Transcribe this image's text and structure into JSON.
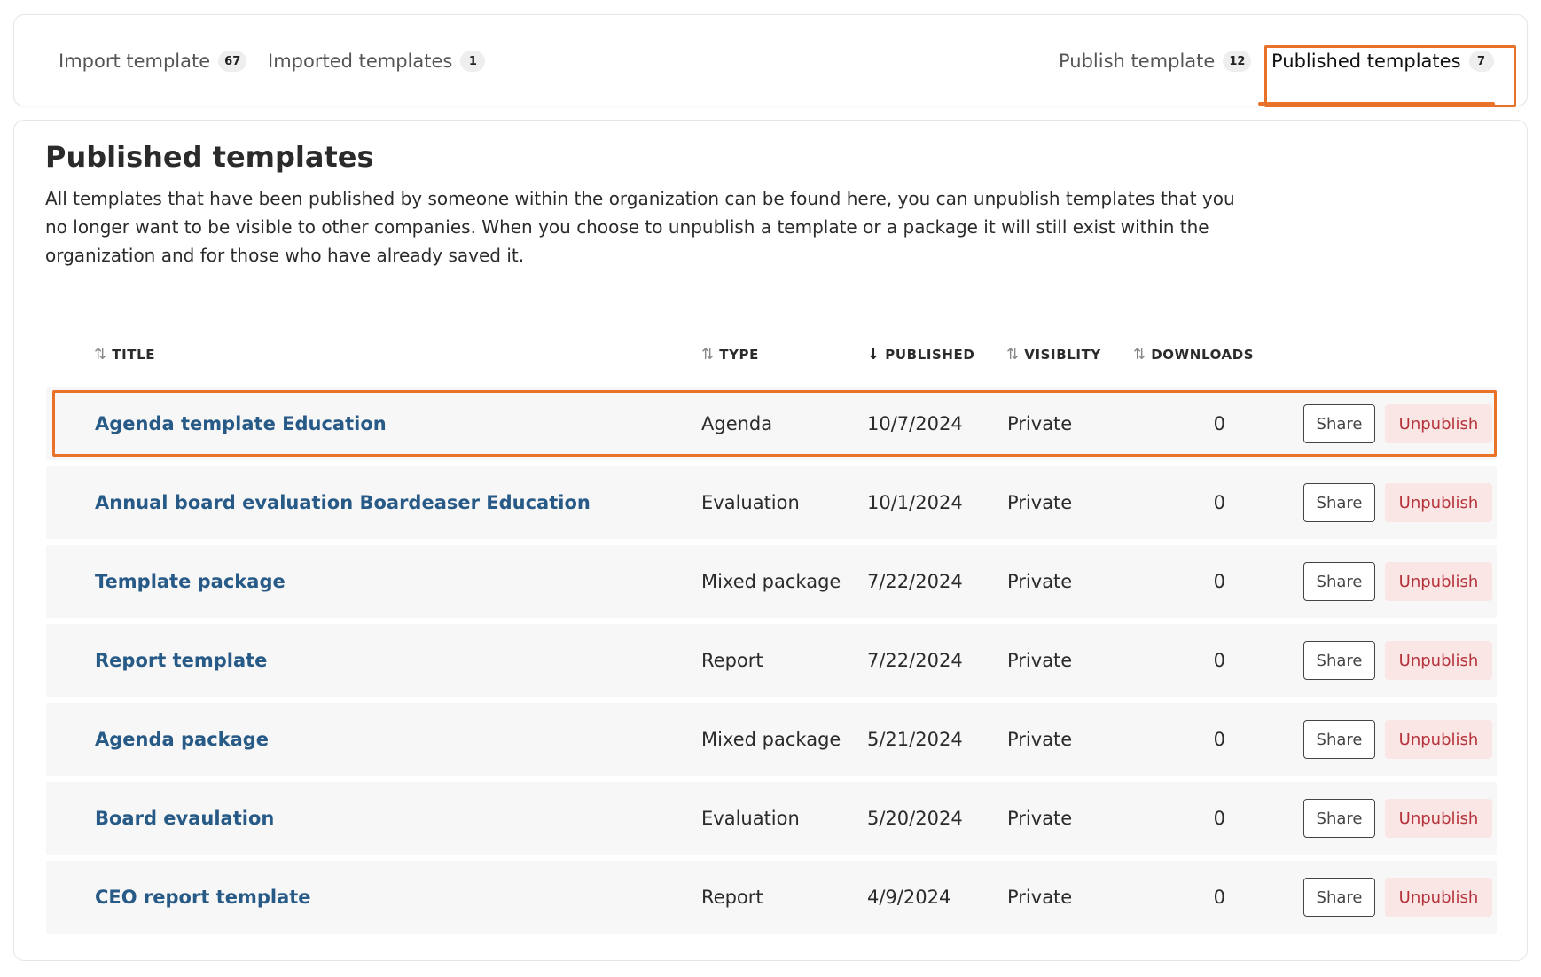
{
  "tabs": [
    {
      "label": "Import template",
      "count": "67"
    },
    {
      "label": "Imported templates",
      "count": "1"
    },
    {
      "label": "Publish template",
      "count": "12"
    },
    {
      "label": "Published templates",
      "count": "7",
      "active": true
    }
  ],
  "page": {
    "title": "Published templates",
    "description": "All templates that have been published by someone within the organization can be found here, you can unpublish templates that you no longer want to be visible to other companies. When you choose to unpublish a template or a package it will still exist within the organization and for those who have already saved it."
  },
  "table": {
    "columns": {
      "title": "TITLE",
      "type": "TYPE",
      "published": "PUBLISHED",
      "visibility": "VISIBLITY",
      "downloads": "DOWNLOADS"
    },
    "sorted_by": "published",
    "share_label": "Share",
    "unpublish_label": "Unpublish",
    "rows": [
      {
        "title": "Agenda template Education",
        "type": "Agenda",
        "published": "10/7/2024",
        "visibility": "Private",
        "downloads": "0"
      },
      {
        "title": "Annual board evaluation Boardeaser Education",
        "type": "Evaluation",
        "published": "10/1/2024",
        "visibility": "Private",
        "downloads": "0"
      },
      {
        "title": "Template package",
        "type": "Mixed package",
        "published": "7/22/2024",
        "visibility": "Private",
        "downloads": "0"
      },
      {
        "title": "Report template",
        "type": "Report",
        "published": "7/22/2024",
        "visibility": "Private",
        "downloads": "0"
      },
      {
        "title": "Agenda package",
        "type": "Mixed package",
        "published": "5/21/2024",
        "visibility": "Private",
        "downloads": "0"
      },
      {
        "title": "Board evaulation",
        "type": "Evaluation",
        "published": "5/20/2024",
        "visibility": "Private",
        "downloads": "0"
      },
      {
        "title": "CEO report template",
        "type": "Report",
        "published": "4/9/2024",
        "visibility": "Private",
        "downloads": "0"
      }
    ]
  },
  "colors": {
    "accent": "#e8722a",
    "link": "#285a87",
    "danger": "#b5333a",
    "danger_bg": "#fbe6e6",
    "row_bg": "#f7f7f7"
  },
  "icons": {
    "sort": "sort-arrows-icon",
    "sorted_desc": "arrow-down-icon"
  }
}
